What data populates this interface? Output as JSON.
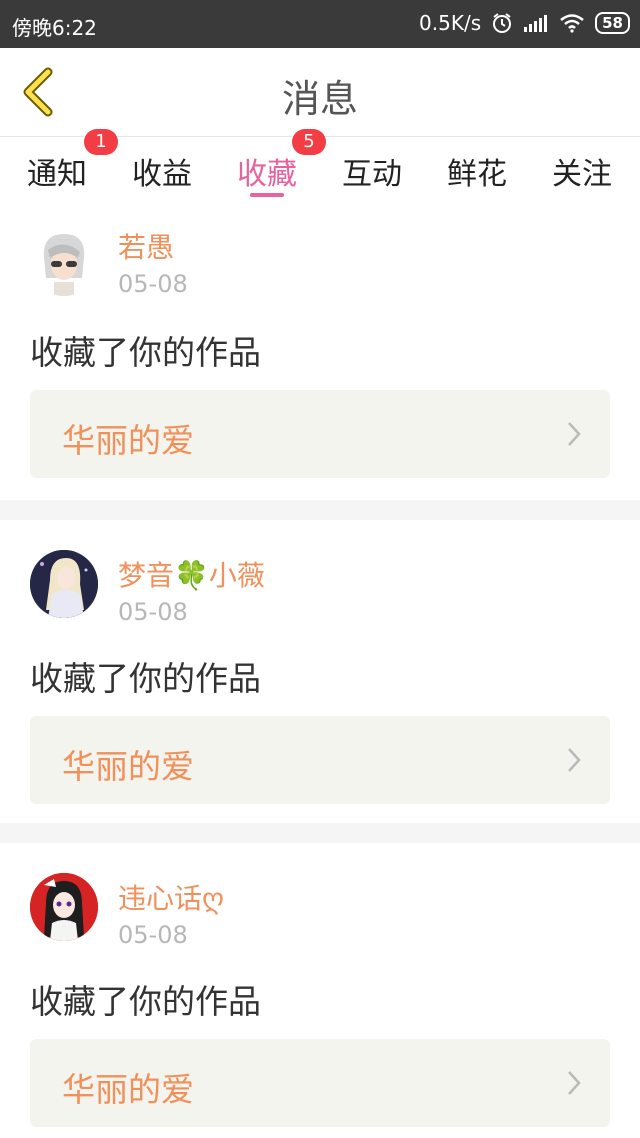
{
  "status_bar": {
    "left_text": "傍晚6:22",
    "speed": "0.5K/s",
    "battery": "58"
  },
  "header": {
    "title": "消息"
  },
  "tabs": [
    {
      "label": "通知",
      "badge": "1"
    },
    {
      "label": "收益",
      "badge": ""
    },
    {
      "label": "收藏",
      "badge": "5"
    },
    {
      "label": "互动",
      "badge": ""
    },
    {
      "label": "鲜花",
      "badge": ""
    },
    {
      "label": "关注",
      "badge": ""
    }
  ],
  "active_tab": "收藏",
  "colors": {
    "accent": "#e8629f",
    "username": "#f0905a",
    "badge": "#f23d45",
    "work_box": "#f4f4ee"
  },
  "items": [
    {
      "username": "若愚",
      "date": "05-08",
      "action": "收藏了你的作品",
      "work_title": "华丽的爱",
      "avatar_icon": "avatar-white-hair-sunglasses"
    },
    {
      "username": "梦音🍀小薇",
      "date": "05-08",
      "action": "收藏了你的作品",
      "work_title": "华丽的爱",
      "avatar_icon": "avatar-girl-blonde-dark-bg"
    },
    {
      "username": "违心话ღ",
      "date": "05-08",
      "action": "收藏了你的作品",
      "work_title": "华丽的爱",
      "avatar_icon": "avatar-girl-red-bg"
    }
  ]
}
